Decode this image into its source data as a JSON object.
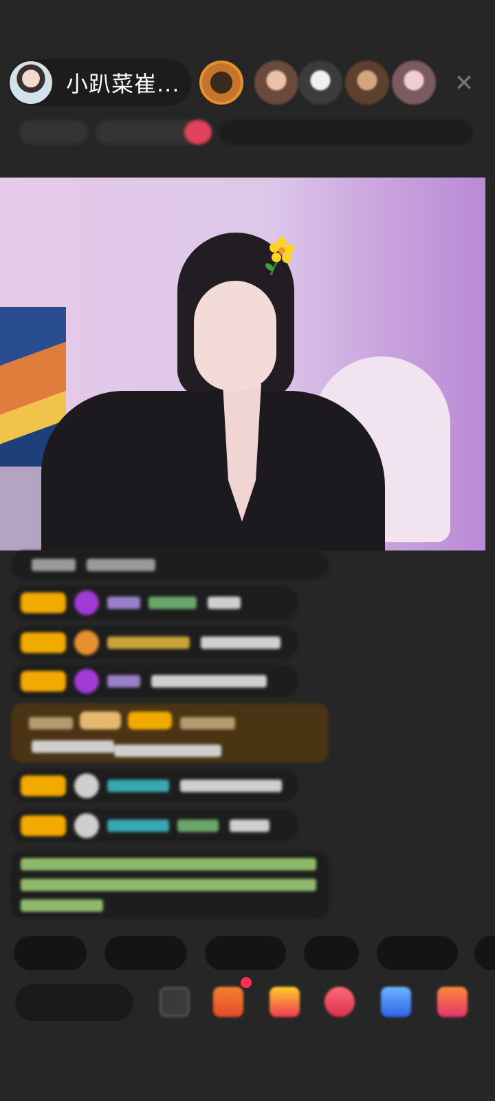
{
  "header": {
    "host_name": "小趴菜崔...",
    "close_icon": "close-icon",
    "viewers": [
      "viewer-1",
      "viewer-2",
      "viewer-3",
      "viewer-4",
      "viewer-5"
    ]
  },
  "video": {
    "sticker_icon": "flower-sticker-icon"
  },
  "chat": {
    "messages": [
      "",
      "",
      "",
      "",
      "",
      "",
      "",
      ""
    ]
  },
  "quick_replies": [
    "",
    "",
    "",
    "",
    ""
  ],
  "toolbar": {
    "comment_placeholder": "",
    "icons": [
      "emoji-icon",
      "gift-box-icon",
      "gift-icon",
      "heart-icon",
      "game-icon",
      "more-icon"
    ]
  },
  "colors": {
    "background": "#262626",
    "badge": "#f2a900",
    "accent": "#e7902f"
  }
}
